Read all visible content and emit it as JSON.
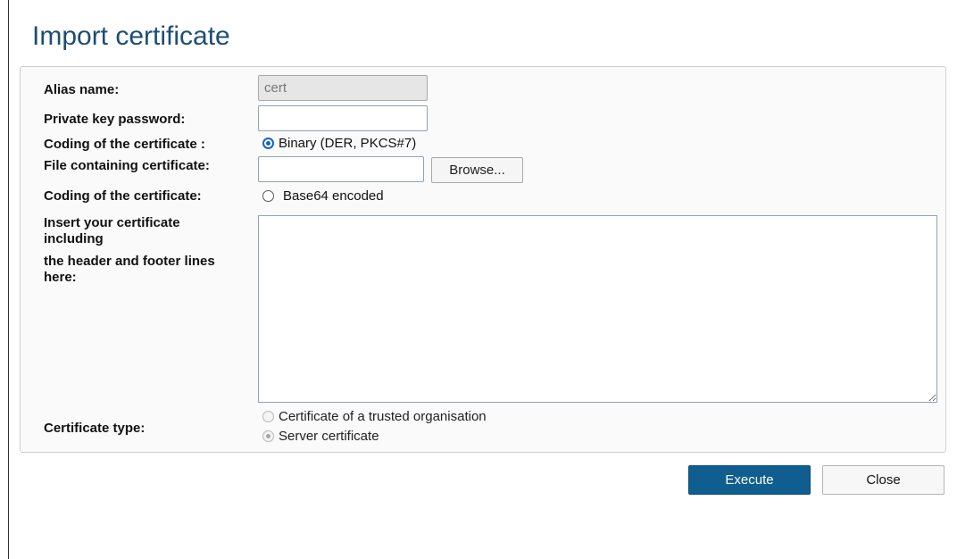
{
  "dialog": {
    "title": "Import certificate"
  },
  "form": {
    "alias_label": "Alias name:",
    "alias_value": "cert",
    "password_label": "Private key password:",
    "password_value": "",
    "coding_binary_label": "Coding of the certificate :",
    "coding_binary_option": "Binary (DER, PKCS#7)",
    "coding_binary_checked": true,
    "file_label": "File containing certificate:",
    "file_value": "",
    "browse_label": "Browse...",
    "coding_base64_label": "Coding of the certificate:",
    "coding_base64_option": "Base64 encoded",
    "coding_base64_checked": false,
    "insert_label_lines": [
      "Insert your certificate",
      "including",
      "the header and footer lines",
      "here:"
    ],
    "certificate_text": "",
    "cert_type_label": "Certificate type:",
    "cert_type_options": [
      "Certificate of a trusted organisation",
      "Server certificate"
    ],
    "cert_type_selected": "Server certificate"
  },
  "footer": {
    "execute_label": "Execute",
    "close_label": "Close"
  },
  "colors": {
    "title": "#1c4e73",
    "primary_button": "#0f5e8f",
    "radio_accent": "#1565c0"
  }
}
